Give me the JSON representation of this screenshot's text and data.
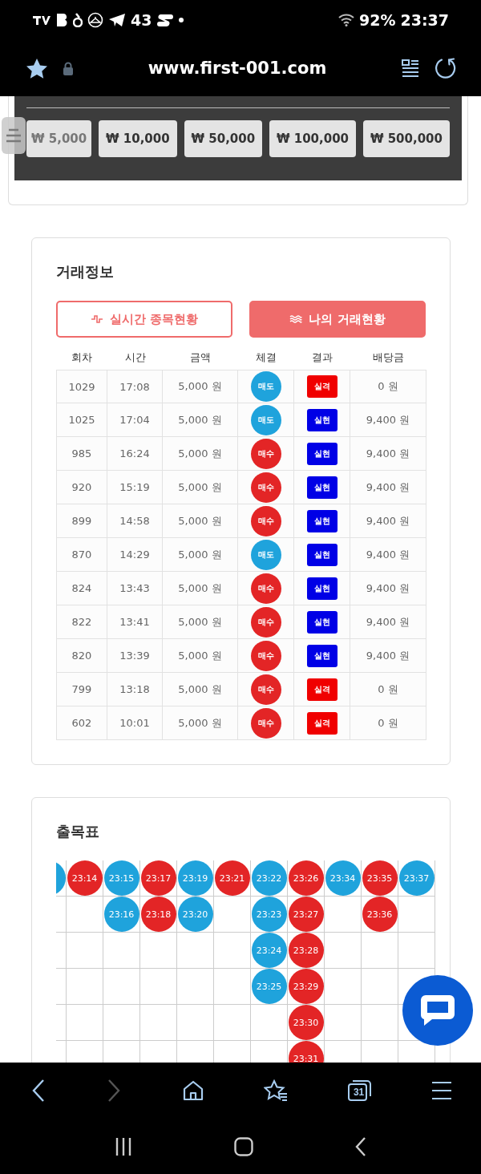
{
  "status_bar": {
    "notification_count": "43",
    "battery": "92%",
    "time": "23:37"
  },
  "address_bar": {
    "url": "www.first-001.com"
  },
  "amount_buttons": [
    "₩ 5,000",
    "₩ 10,000",
    "₩ 50,000",
    "₩ 100,000",
    "₩ 500,000"
  ],
  "trade_info": {
    "title": "거래정보",
    "tabs": [
      {
        "label": "실시간 종목현황",
        "selected": false
      },
      {
        "label": "나의 거래현황",
        "selected": true
      }
    ],
    "columns": [
      "회차",
      "시간",
      "금액",
      "체결",
      "결과",
      "배당금"
    ],
    "rows": [
      {
        "round": "1029",
        "time": "17:08",
        "amount": "5,000 원",
        "side": {
          "label": "매도",
          "kind": "sell"
        },
        "result": {
          "label": "실격",
          "kind": "lose"
        },
        "payout": "0 원"
      },
      {
        "round": "1025",
        "time": "17:04",
        "amount": "5,000 원",
        "side": {
          "label": "매도",
          "kind": "sell"
        },
        "result": {
          "label": "실현",
          "kind": "win"
        },
        "payout": "9,400 원"
      },
      {
        "round": "985",
        "time": "16:24",
        "amount": "5,000 원",
        "side": {
          "label": "매수",
          "kind": "buy"
        },
        "result": {
          "label": "실현",
          "kind": "win"
        },
        "payout": "9,400 원"
      },
      {
        "round": "920",
        "time": "15:19",
        "amount": "5,000 원",
        "side": {
          "label": "매수",
          "kind": "buy"
        },
        "result": {
          "label": "실현",
          "kind": "win"
        },
        "payout": "9,400 원"
      },
      {
        "round": "899",
        "time": "14:58",
        "amount": "5,000 원",
        "side": {
          "label": "매수",
          "kind": "buy"
        },
        "result": {
          "label": "실현",
          "kind": "win"
        },
        "payout": "9,400 원"
      },
      {
        "round": "870",
        "time": "14:29",
        "amount": "5,000 원",
        "side": {
          "label": "매도",
          "kind": "sell"
        },
        "result": {
          "label": "실현",
          "kind": "win"
        },
        "payout": "9,400 원"
      },
      {
        "round": "824",
        "time": "13:43",
        "amount": "5,000 원",
        "side": {
          "label": "매수",
          "kind": "buy"
        },
        "result": {
          "label": "실현",
          "kind": "win"
        },
        "payout": "9,400 원"
      },
      {
        "round": "822",
        "time": "13:41",
        "amount": "5,000 원",
        "side": {
          "label": "매수",
          "kind": "buy"
        },
        "result": {
          "label": "실현",
          "kind": "win"
        },
        "payout": "9,400 원"
      },
      {
        "round": "820",
        "time": "13:39",
        "amount": "5,000 원",
        "side": {
          "label": "매수",
          "kind": "buy"
        },
        "result": {
          "label": "실현",
          "kind": "win"
        },
        "payout": "9,400 원"
      },
      {
        "round": "799",
        "time": "13:18",
        "amount": "5,000 원",
        "side": {
          "label": "매수",
          "kind": "buy"
        },
        "result": {
          "label": "실격",
          "kind": "lose"
        },
        "payout": "0 원"
      },
      {
        "round": "602",
        "time": "10:01",
        "amount": "5,000 원",
        "side": {
          "label": "매수",
          "kind": "buy"
        },
        "result": {
          "label": "실격",
          "kind": "lose"
        },
        "payout": "0 원"
      }
    ]
  },
  "result_board": {
    "title": "출목표",
    "columns": [
      [
        {
          "color": "#1fa3dc"
        }
      ],
      [
        {
          "time": "23:14",
          "color": "#e32526"
        }
      ],
      [
        {
          "time": "23:15",
          "color": "#1fa3dc"
        },
        {
          "time": "23:16",
          "color": "#1fa3dc"
        }
      ],
      [
        {
          "time": "23:17",
          "color": "#e32526"
        },
        {
          "time": "23:18",
          "color": "#e32526"
        }
      ],
      [
        {
          "time": "23:19",
          "color": "#1fa3dc"
        },
        {
          "time": "23:20",
          "color": "#1fa3dc"
        }
      ],
      [
        {
          "time": "23:21",
          "color": "#e32526"
        }
      ],
      [
        {
          "time": "23:22",
          "color": "#1fa3dc"
        },
        {
          "time": "23:23",
          "color": "#1fa3dc"
        },
        {
          "time": "23:24",
          "color": "#1fa3dc"
        },
        {
          "time": "23:25",
          "color": "#1fa3dc"
        }
      ],
      [
        {
          "time": "23:26",
          "color": "#e32526"
        },
        {
          "time": "23:27",
          "color": "#e32526"
        },
        {
          "time": "23:28",
          "color": "#e32526"
        },
        {
          "time": "23:29",
          "color": "#e32526"
        },
        {
          "time": "23:30",
          "color": "#e32526"
        },
        {
          "time": "23:31",
          "color": "#e32526"
        }
      ],
      [
        {
          "time": "23:34",
          "color": "#1fa3dc"
        }
      ],
      [
        {
          "time": "23:35",
          "color": "#e32526"
        },
        {
          "time": "23:36",
          "color": "#e32526"
        }
      ],
      [
        {
          "time": "23:37",
          "color": "#1fa3dc"
        }
      ]
    ]
  },
  "browser_nav": {
    "forward_disabled": true,
    "tabs_count": "31"
  }
}
